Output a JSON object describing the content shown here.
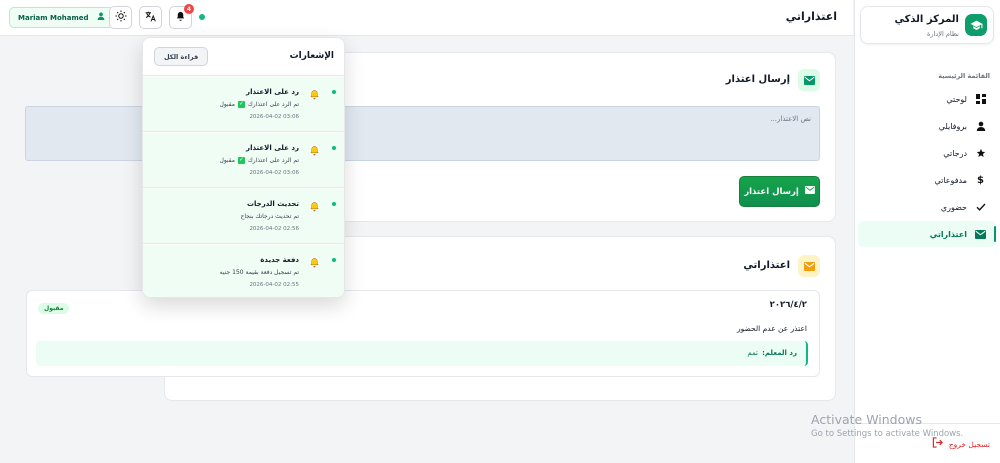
{
  "sidebar": {
    "brand_title": "المركز الذكي",
    "brand_subtitle": "نظام الإدارة",
    "menu_heading": "القائمة الرئيسية",
    "items": [
      {
        "label": "لوحتي",
        "icon": "dashboard-icon"
      },
      {
        "label": "بروفايلي",
        "icon": "user-icon"
      },
      {
        "label": "درجاتي",
        "icon": "star-icon"
      },
      {
        "label": "مدفوعاتي",
        "icon": "dollar-icon"
      },
      {
        "label": "حضوري",
        "icon": "check-icon"
      },
      {
        "label": "اعتذاراتي",
        "icon": "envelope-icon",
        "active": true
      }
    ],
    "logout_label": "تسجيل خروج"
  },
  "header": {
    "title": "اعتذاراتي",
    "user_name": "Mariam Mohamed",
    "notification_count": "4"
  },
  "send_card": {
    "title": "إرسال اعتذار",
    "textarea_placeholder": "نص الاعتذار...",
    "send_button": "إرسال اعتذار"
  },
  "excuses_card": {
    "title": "اعتذاراتي",
    "items": [
      {
        "date": "٢٠٢٦/٤/٢",
        "text": "اعتذر عن عدم الحضور",
        "status": "مقبول",
        "reply_label": "رد المعلم:",
        "reply_text": "تمم"
      }
    ]
  },
  "notifications": {
    "title": "الإشعارات",
    "mark_all": "قراءة الكل",
    "items": [
      {
        "title": "رد على الاعتذار",
        "msg_before": "تم الرد على اعتذارك",
        "msg_after": "مقبول",
        "date": "2026-04-02 03:06"
      },
      {
        "title": "رد على الاعتذار",
        "msg_before": "تم الرد على اعتذارك",
        "msg_after": "مقبول",
        "date": "2026-04-02 03:06"
      },
      {
        "title": "تحديث الدرجات",
        "msg_before": "تم تحديث درجاتك بنجاح",
        "msg_after": "",
        "date": "2026-04-02 02:56"
      },
      {
        "title": "دفعة جديدة",
        "msg_before": "تم تسجيل دفعة بقيمة 150 جنيه",
        "msg_after": "",
        "date": "2026-04-02 02:55"
      }
    ]
  },
  "watermark": {
    "line1": "Activate Windows",
    "line2": "Go to Settings to activate Windows."
  },
  "colors": {
    "accent": "#10b981",
    "primary_button": "#16a34a",
    "badge": "#ef4444",
    "logout": "#dc2626"
  }
}
